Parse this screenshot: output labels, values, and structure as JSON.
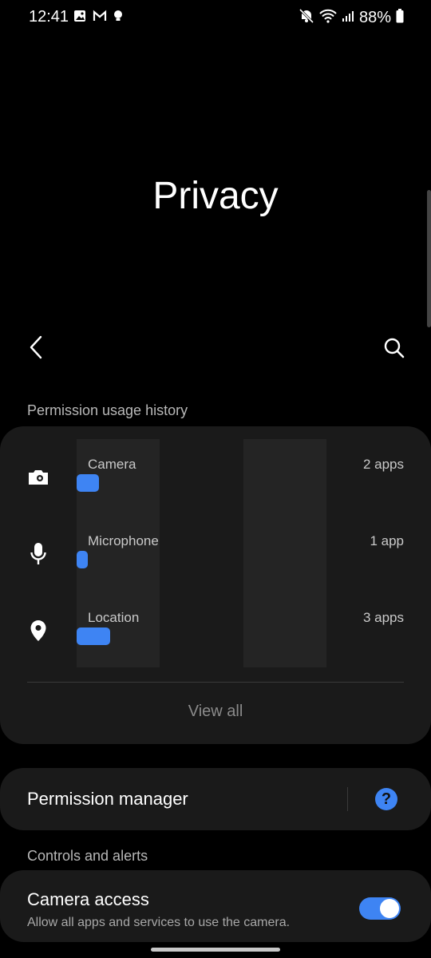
{
  "status_bar": {
    "time": "12:41",
    "battery": "88%",
    "left_icons": [
      "image-icon",
      "gmail-icon",
      "bulb-icon"
    ],
    "right_icons": [
      "mute-icon",
      "wifi-icon",
      "signal-icon",
      "battery-icon"
    ]
  },
  "page": {
    "title": "Privacy"
  },
  "toolbar": {
    "back_icon": "chevron-left-icon",
    "search_icon": "search-icon"
  },
  "permission_history": {
    "header": "Permission usage history",
    "items": [
      {
        "label": "Camera",
        "count": "2 apps",
        "icon": "camera-icon"
      },
      {
        "label": "Microphone",
        "count": "1 app",
        "icon": "microphone-icon"
      },
      {
        "label": "Location",
        "count": "3 apps",
        "icon": "location-pin-icon"
      }
    ],
    "view_all": "View all"
  },
  "permission_manager": {
    "label": "Permission manager",
    "help_icon": "help-icon",
    "help_glyph": "?"
  },
  "controls": {
    "header": "Controls and alerts",
    "camera_access": {
      "title": "Camera access",
      "subtitle": "Allow all apps and services to use the camera.",
      "enabled": true
    }
  },
  "colors": {
    "accent": "#3e84f3",
    "card": "#1a1a1a",
    "background": "#000000"
  }
}
